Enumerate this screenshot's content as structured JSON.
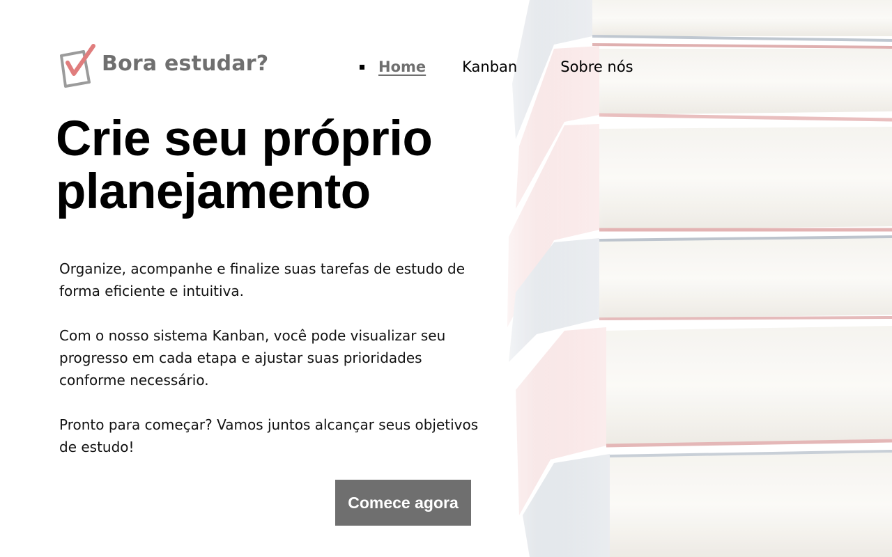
{
  "header": {
    "brand": "Bora estudar?",
    "logo_icon": "checkbox-check-icon",
    "nav": [
      {
        "label": "Home",
        "active": true
      },
      {
        "label": "Kanban",
        "active": false
      },
      {
        "label": "Sobre nós",
        "active": false
      }
    ]
  },
  "hero": {
    "title_line1": "Crie seu próprio",
    "title_line2": "planejamento",
    "paragraphs": [
      "Organize, acompanhe e finalize suas tarefas de estudo de forma eficiente e intuitiva.",
      "Com o nosso sistema Kanban, você pode visualizar seu progresso em cada etapa e ajustar suas prioridades conforme necessário.",
      "Pronto para começar? Vamos juntos alcançar seus objetivos de estudo!"
    ],
    "cta_label": "Comece agora"
  },
  "background": {
    "image": "stack-of-books"
  },
  "colors": {
    "accent_gray": "#6f6f6f",
    "logo_check": "#e07d7d",
    "text": "#000000",
    "background": "#ffffff"
  }
}
